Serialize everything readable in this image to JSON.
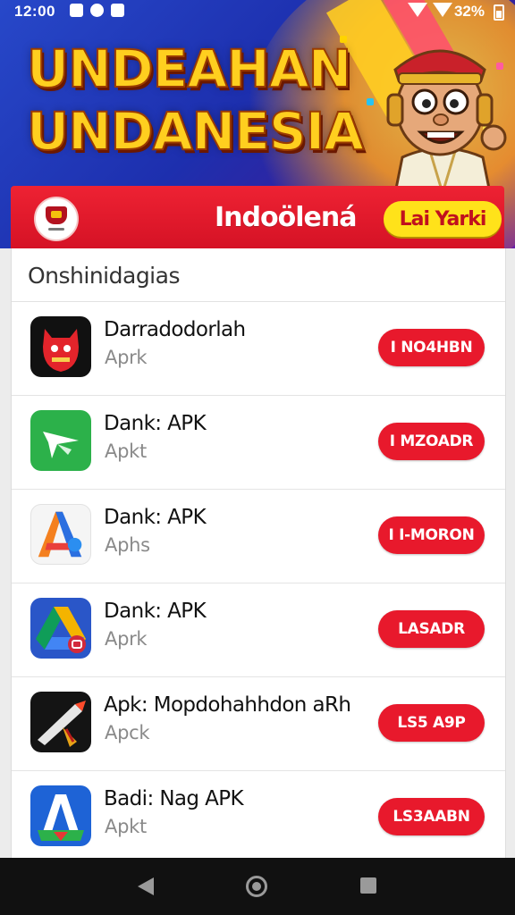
{
  "status_bar": {
    "time": "12:00",
    "battery": "32%"
  },
  "hero": {
    "title_line1": "UNDEAHAN",
    "title_line2": "UNDANESIA"
  },
  "header_bar": {
    "brand": "Indoölená",
    "cta_label": "Lai Yarki"
  },
  "list": {
    "heading": "Onshinidagias",
    "items": [
      {
        "name": "Darradodorlah",
        "sub": "Aprk",
        "button": "I NO4HBN",
        "icon": "red-devil-app-icon"
      },
      {
        "name": "Dank: APK",
        "sub": "Apkt",
        "button": "I MZOADR",
        "icon": "green-plane-app-icon"
      },
      {
        "name": "Dank: APK",
        "sub": "Aphs",
        "button": "I I-MORON",
        "icon": "colorful-a-app-icon"
      },
      {
        "name": "Dank: APK",
        "sub": "Aprk",
        "button": "LASADR",
        "icon": "drive-triangle-app-icon"
      },
      {
        "name": "Apk: Mopdohahhdon aRh",
        "sub": "Apck",
        "button": "LS5 A9P",
        "icon": "pen-tool-app-icon"
      },
      {
        "name": "Badi: Nag APK",
        "sub": "Apkt",
        "button": "LS3AABN",
        "icon": "blue-a-frame-app-icon"
      }
    ]
  },
  "colors": {
    "accent_red": "#e8192c",
    "title_yellow": "#ffcf1f",
    "cta_yellow": "#ffe21a",
    "hero_blue": "#2748c9"
  }
}
